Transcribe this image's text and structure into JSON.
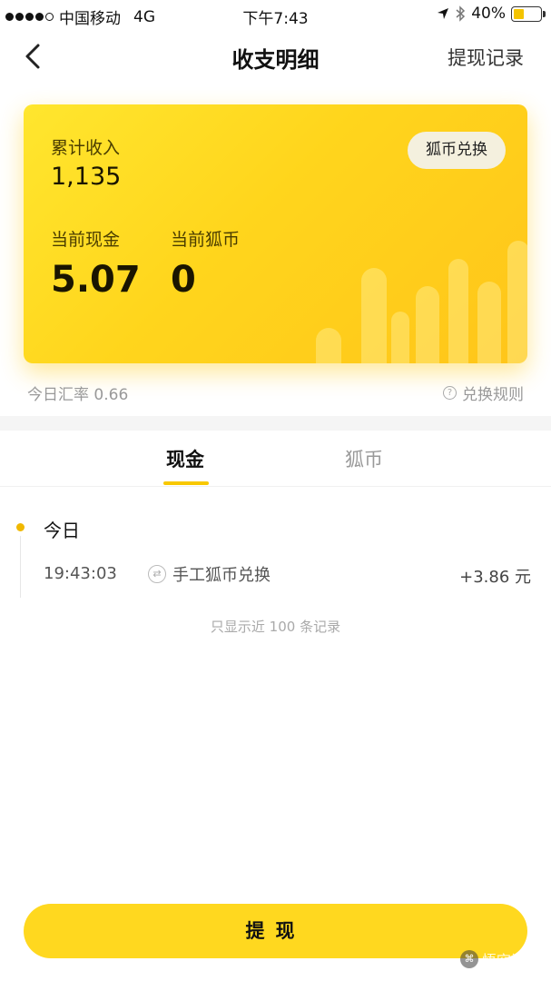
{
  "status_bar": {
    "carrier": "中国移动",
    "network": "4G",
    "time": "下午7:43",
    "battery": "40%",
    "battery_level": 0.4
  },
  "nav": {
    "title": "收支明细",
    "right_action": "提现记录"
  },
  "card": {
    "total_income_label": "累计收入",
    "total_income_value": "1,135",
    "exchange_button": "狐币兑换",
    "current_cash_label": "当前现金",
    "current_cash_value": "5.07",
    "current_coin_label": "当前狐币",
    "current_coin_value": "0"
  },
  "rate_text": "今日汇率 0.66",
  "rules_link": "兑换规则",
  "tabs": [
    {
      "label": "现金",
      "active": true
    },
    {
      "label": "狐币",
      "active": false
    }
  ],
  "records": {
    "day_label": "今日",
    "items": [
      {
        "time": "19:43:03",
        "type": "手工狐币兑换",
        "amount": "+3.86 元"
      }
    ],
    "hint": "只显示近 100 条记录"
  },
  "withdraw_button": "提现",
  "watermark": "悟空问答",
  "colors": {
    "accent": "#ffd81f",
    "card_gradient_start": "#ffe62e",
    "card_gradient_end": "#ffc51a",
    "muted_text": "#999999"
  }
}
